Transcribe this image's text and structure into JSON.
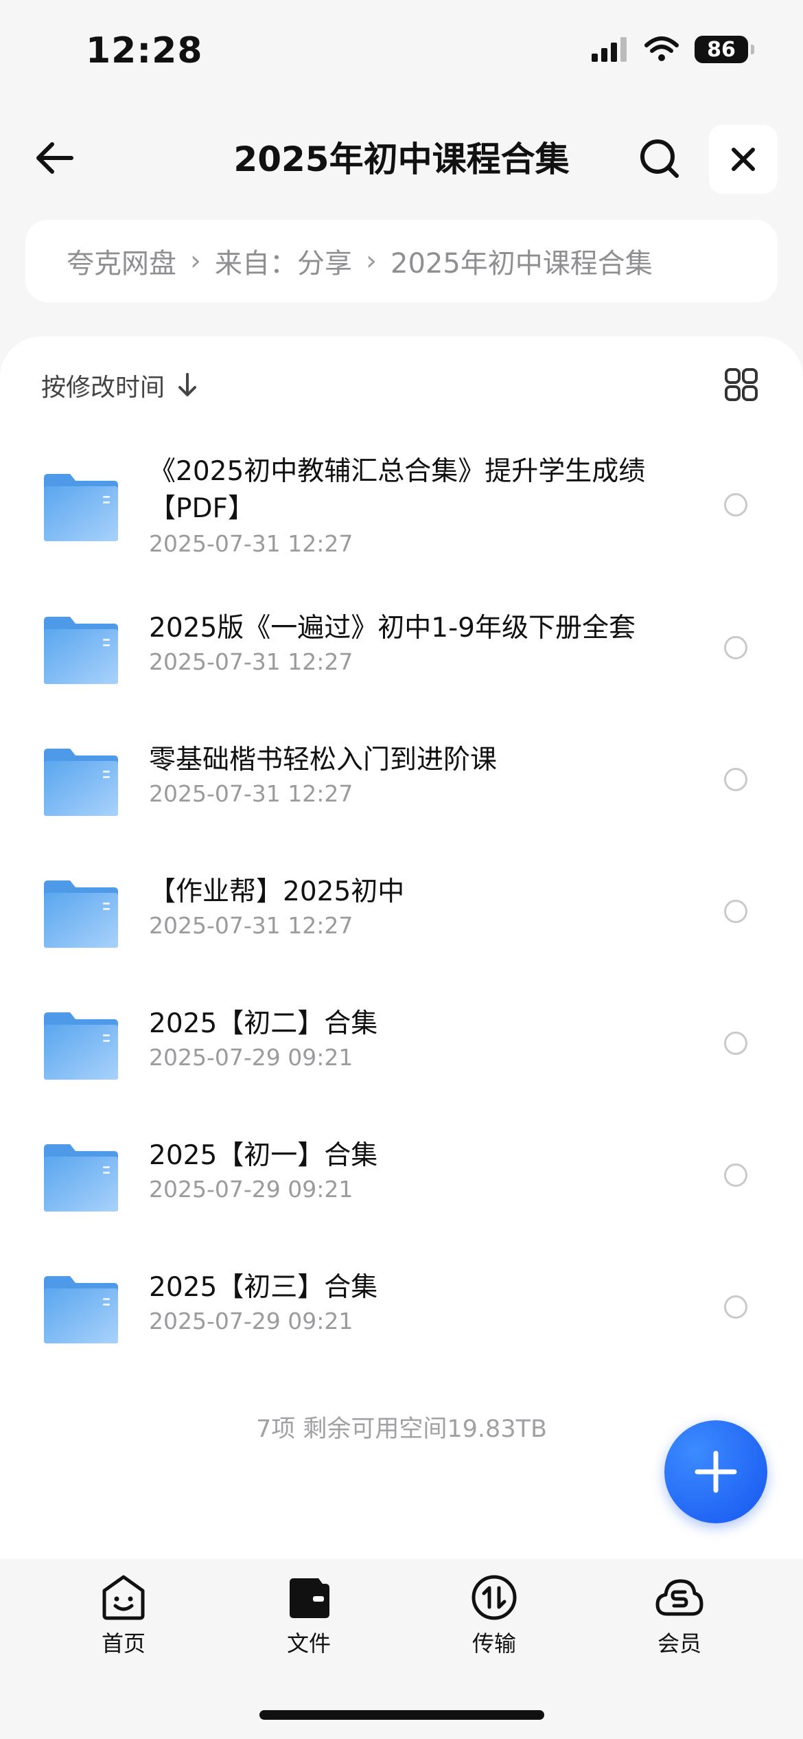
{
  "status_bar": {
    "time": "12:28",
    "battery": "86"
  },
  "header": {
    "title": "2025年初中课程合集"
  },
  "breadcrumb": {
    "items": [
      "夸克网盘",
      "来自：分享",
      "2025年初中课程合集"
    ],
    "separator": "›"
  },
  "sort": {
    "label": "按修改时间"
  },
  "files": [
    {
      "name": "《2025初中教辅汇总合集》提升学生成绩【PDF】",
      "date": "2025-07-31 12:27"
    },
    {
      "name": "2025版《一遍过》初中1-9年级下册全套",
      "date": "2025-07-31 12:27"
    },
    {
      "name": "零基础楷书轻松入门到进阶课",
      "date": "2025-07-31 12:27"
    },
    {
      "name": "【作业帮】2025初中",
      "date": "2025-07-31 12:27"
    },
    {
      "name": "2025【初二】合集",
      "date": "2025-07-29 09:21"
    },
    {
      "name": "2025【初一】合集",
      "date": "2025-07-29 09:21"
    },
    {
      "name": "2025【初三】合集",
      "date": "2025-07-29 09:21"
    }
  ],
  "footer": {
    "summary": "7项 剩余可用空间19.83TB"
  },
  "tabbar": {
    "tabs": [
      {
        "label": "首页",
        "icon": "smile-home-icon"
      },
      {
        "label": "文件",
        "icon": "wallet-folder-icon"
      },
      {
        "label": "传输",
        "icon": "transfer-icon"
      },
      {
        "label": "会员",
        "icon": "cloud-member-icon"
      }
    ]
  },
  "colors": {
    "accent": "#1656f0",
    "folder": "#6fb3f5",
    "background": "#f6f6f7"
  }
}
